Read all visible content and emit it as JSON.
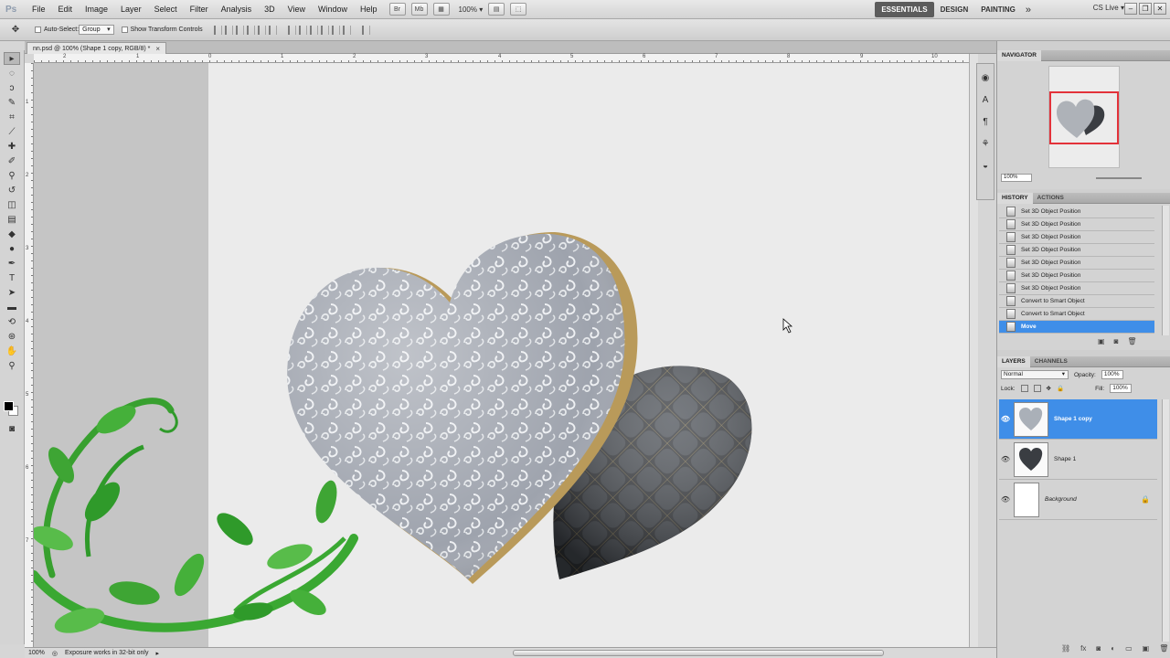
{
  "menubar": {
    "logo": "Ps",
    "items": [
      "File",
      "Edit",
      "Image",
      "Layer",
      "Select",
      "Filter",
      "Analysis",
      "3D",
      "View",
      "Window",
      "Help"
    ],
    "zoom": "100%",
    "workspaces": [
      "ESSENTIALS",
      "DESIGN",
      "PAINTING"
    ],
    "more": "»",
    "cs_live": "CS Live"
  },
  "options": {
    "auto_select_label": "Auto-Select:",
    "auto_select_value": "Group",
    "transform_label": "Show Transform Controls"
  },
  "document": {
    "tab_title": "nn.psd @ 100% (Shape 1 copy, RGB/8) *",
    "close": "×"
  },
  "rulers": {
    "top": [
      "2",
      "1",
      "0",
      "1",
      "2",
      "3",
      "4",
      "5",
      "6",
      "7",
      "8",
      "9",
      "10"
    ],
    "left": [
      "1",
      "2",
      "3",
      "4",
      "5",
      "6",
      "7"
    ]
  },
  "status": {
    "zoom": "100%",
    "message": "Exposure works in 32-bit only"
  },
  "navigator": {
    "tab": "NAVIGATOR",
    "zoom": "100%"
  },
  "history": {
    "tabs": [
      "HISTORY",
      "ACTIONS"
    ],
    "items": [
      "Set 3D Object Position",
      "Set 3D Object Position",
      "Set 3D Object Position",
      "Set 3D Object Position",
      "Set 3D Object Position",
      "Set 3D Object Position",
      "Set 3D Object Position",
      "Convert to Smart Object",
      "Convert to Smart Object",
      "Move"
    ]
  },
  "layers": {
    "tabs": [
      "LAYERS",
      "CHANNELS"
    ],
    "blend_mode": "Normal",
    "opacity_label": "Opacity:",
    "opacity": "100%",
    "lock_label": "Lock:",
    "fill_label": "Fill:",
    "fill": "100%",
    "items": [
      "Shape 1 copy",
      "Shape 1",
      "Background"
    ]
  },
  "colors": {
    "selection": "#3f8ee8",
    "canvas": "#ebebeb",
    "nav_frame": "#e3323a",
    "leaf_green": "#2f9a2a"
  }
}
